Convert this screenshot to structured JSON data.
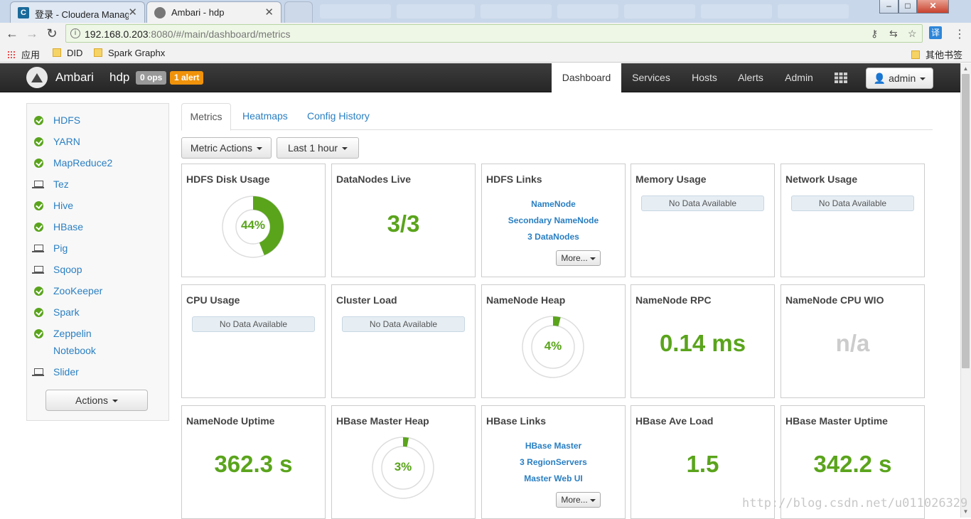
{
  "browser": {
    "tabs": [
      {
        "title": "登录 - Cloudera Manag",
        "favicon": "C"
      },
      {
        "title": "Ambari - hdp"
      }
    ],
    "window_buttons": [
      "–",
      "□",
      "✕"
    ],
    "url_host": "192.168.0.203",
    "url_rest": ":8080/#/main/dashboard/metrics",
    "bookmarks": [
      "应用",
      "DID",
      "Spark Graphx"
    ],
    "other_bookmarks": "其他书签",
    "ext_label": "译"
  },
  "topnav": {
    "brand": "Ambari",
    "cluster": "hdp",
    "ops_badge": "0 ops",
    "alert_badge": "1 alert",
    "items": [
      "Dashboard",
      "Services",
      "Hosts",
      "Alerts",
      "Admin"
    ],
    "user": "admin"
  },
  "sidebar": {
    "services": [
      {
        "name": "HDFS",
        "status": "ok"
      },
      {
        "name": "YARN",
        "status": "ok"
      },
      {
        "name": "MapReduce2",
        "status": "ok"
      },
      {
        "name": "Tez",
        "status": "client"
      },
      {
        "name": "Hive",
        "status": "ok"
      },
      {
        "name": "HBase",
        "status": "ok"
      },
      {
        "name": "Pig",
        "status": "client"
      },
      {
        "name": "Sqoop",
        "status": "client"
      },
      {
        "name": "ZooKeeper",
        "status": "ok"
      },
      {
        "name": "Spark",
        "status": "ok"
      },
      {
        "name": "Zeppelin",
        "name2": "Notebook",
        "status": "ok"
      },
      {
        "name": "Slider",
        "status": "client"
      }
    ],
    "actions_label": "Actions"
  },
  "tabs": [
    "Metrics",
    "Heatmaps",
    "Config History"
  ],
  "filters": {
    "metric_actions": "Metric Actions",
    "time_range": "Last 1 hour"
  },
  "widgets": {
    "hdfs_disk": {
      "title": "HDFS Disk Usage",
      "percent_label": "44%",
      "percent": 44
    },
    "datanodes": {
      "title": "DataNodes Live",
      "value": "3/3"
    },
    "hdfs_links": {
      "title": "HDFS Links",
      "links": [
        "NameNode",
        "Secondary NameNode",
        "3 DataNodes"
      ],
      "more": "More..."
    },
    "memory": {
      "title": "Memory Usage",
      "nodata": "No Data Available"
    },
    "network": {
      "title": "Network Usage",
      "nodata": "No Data Available"
    },
    "cpu": {
      "title": "CPU Usage",
      "nodata": "No Data Available"
    },
    "cluster_load": {
      "title": "Cluster Load",
      "nodata": "No Data Available"
    },
    "nn_heap": {
      "title": "NameNode Heap",
      "percent_label": "4%",
      "percent": 4
    },
    "nn_rpc": {
      "title": "NameNode RPC",
      "value": "0.14 ms"
    },
    "nn_cpu_wio": {
      "title": "NameNode CPU WIO",
      "value": "n/a"
    },
    "nn_uptime": {
      "title": "NameNode Uptime",
      "value": "362.3 s"
    },
    "hbase_heap": {
      "title": "HBase Master Heap",
      "percent_label": "3%",
      "percent": 3
    },
    "hbase_links": {
      "title": "HBase Links",
      "links": [
        "HBase Master",
        "3 RegionServers",
        "Master Web UI"
      ],
      "more": "More..."
    },
    "hbase_load": {
      "title": "HBase Ave Load",
      "value": "1.5"
    },
    "hbase_uptime": {
      "title": "HBase Master Uptime",
      "value": "342.2 s"
    }
  },
  "colors": {
    "accent_green": "#5aa41c",
    "link_blue": "#2a7fc2",
    "alert_orange": "#f0930b"
  },
  "watermark": "http://blog.csdn.net/u011026329"
}
